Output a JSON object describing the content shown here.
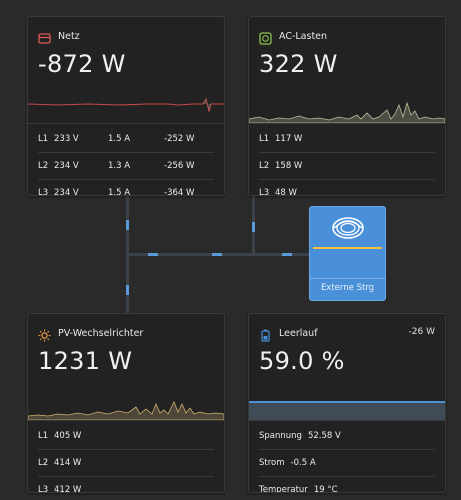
{
  "grid": {
    "title": "Netz",
    "value": "-872 W",
    "rows": [
      {
        "phase": "L1",
        "voltage": "233 V",
        "current": "1.5 A",
        "power": "-252 W"
      },
      {
        "phase": "L2",
        "voltage": "234 V",
        "current": "1.3 A",
        "power": "-256 W"
      },
      {
        "phase": "L3",
        "voltage": "234 V",
        "current": "1.5 A",
        "power": "-364 W"
      }
    ]
  },
  "ac_loads": {
    "title": "AC-Lasten",
    "value": "322 W",
    "rows": [
      {
        "phase": "L1",
        "power": "117 W"
      },
      {
        "phase": "L2",
        "power": "158 W"
      },
      {
        "phase": "L3",
        "power": "48 W"
      }
    ]
  },
  "pv_inverter": {
    "title": "PV-Wechselrichter",
    "value": "1231 W",
    "rows": [
      {
        "phase": "L1",
        "power": "405 W"
      },
      {
        "phase": "L2",
        "power": "414 W"
      },
      {
        "phase": "L3",
        "power": "412 W"
      }
    ]
  },
  "battery": {
    "title": "Leerlauf",
    "power": "-26 W",
    "value": "59.0 %",
    "rows": [
      {
        "label": "Spannung",
        "value": "52.58 V"
      },
      {
        "label": "Strom",
        "value": "-0.5 A"
      },
      {
        "label": "Temperatur",
        "value": "19 °C"
      }
    ]
  },
  "external_control": {
    "label": "Externe Strg"
  },
  "colors": {
    "background": "#2a2a2a",
    "card": "#222222",
    "grid_icon": "#e05a5a",
    "ac_icon": "#8bc34a",
    "pv_icon": "#f0a040",
    "battery_icon": "#4a90d9",
    "external_box": "#4a90d9",
    "wire": "#3a4148",
    "flow": "#5a9ad9"
  },
  "icons": {
    "grid": "grid-tower-icon",
    "ac_loads": "ac-plug-icon",
    "pv": "sun-icon",
    "battery": "battery-icon",
    "external": "victron-logo-icon"
  }
}
